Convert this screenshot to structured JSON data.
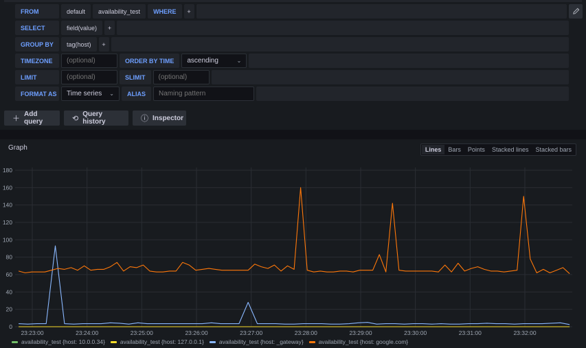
{
  "query_editor": {
    "from": {
      "label": "FROM",
      "policy": "default",
      "measurement": "availability_test",
      "where_label": "WHERE",
      "add": "+"
    },
    "select": {
      "label": "SELECT",
      "field": "field(value)",
      "add": "+"
    },
    "group_by": {
      "label": "GROUP BY",
      "tag": "tag(host)",
      "add": "+"
    },
    "timezone": {
      "label": "TIMEZONE",
      "placeholder": "(optional)",
      "order_label": "ORDER BY TIME",
      "order_value": "ascending"
    },
    "limit": {
      "label": "LIMIT",
      "placeholder": "(optional)",
      "slimit_label": "SLIMIT",
      "slimit_placeholder": "(optional)"
    },
    "format": {
      "label": "FORMAT AS",
      "value": "Time series",
      "alias_label": "ALIAS",
      "alias_placeholder": "Naming pattern"
    },
    "edit_icon": "pencil-icon"
  },
  "actions": {
    "add_query": {
      "label": "Add query",
      "icon": "plus-icon"
    },
    "query_history": {
      "label": "Query history",
      "icon": "history-icon"
    },
    "inspector": {
      "label": "Inspector",
      "icon": "info-icon"
    }
  },
  "panel": {
    "title": "Graph",
    "viz_tabs": [
      "Lines",
      "Bars",
      "Points",
      "Stacked lines",
      "Stacked bars"
    ],
    "active_tab": "Lines"
  },
  "chart_data": {
    "type": "line",
    "title": "Graph",
    "xlabel": "",
    "ylabel": "",
    "ylim": [
      0,
      180
    ],
    "yticks": [
      0,
      20,
      40,
      60,
      80,
      100,
      120,
      140,
      160,
      180
    ],
    "xticks": [
      "23:23:00",
      "23:24:00",
      "23:25:00",
      "23:26:00",
      "23:27:00",
      "23:28:00",
      "23:29:00",
      "23:30:00",
      "23:31:00",
      "23:32:00"
    ],
    "x_start": "23:22:45",
    "x_step_seconds": 10,
    "grid": true,
    "legend_position": "bottom-left",
    "series": [
      {
        "name": "availability_test {host: 10.0.0.34}",
        "color": "#73bf69",
        "values": [
          0,
          0,
          0,
          0,
          0,
          0,
          0,
          0,
          0,
          0,
          0,
          0,
          0,
          0,
          0,
          0,
          0,
          0,
          0,
          0,
          0,
          0,
          0,
          0,
          0,
          0,
          0,
          0,
          0,
          0,
          0,
          0,
          0,
          0,
          0,
          0,
          0,
          0,
          0,
          0,
          0,
          0,
          0,
          0,
          0,
          0,
          0,
          0,
          0,
          0,
          0,
          0,
          0,
          0,
          0,
          0,
          0,
          0,
          0,
          0,
          0
        ]
      },
      {
        "name": "availability_test {host: 127.0.0.1}",
        "color": "#fade2a",
        "values": [
          0,
          0,
          0,
          0,
          0,
          0,
          0,
          0,
          0,
          0,
          0,
          0,
          0,
          0,
          0,
          0,
          0,
          0,
          0,
          0,
          0,
          0,
          0,
          0,
          0,
          0,
          0,
          0,
          0,
          0,
          0,
          0,
          0,
          0,
          0,
          0,
          0,
          0,
          0,
          0,
          0,
          0,
          0,
          0,
          0,
          0,
          0,
          0,
          0,
          0,
          0,
          0,
          0,
          0,
          0,
          0,
          0,
          0,
          0,
          0,
          0
        ]
      },
      {
        "name": "availability_test {host: _gateway}",
        "color": "#8ab8ff",
        "values": [
          3.5,
          3,
          3.5,
          3.5,
          93,
          3.5,
          3,
          3.5,
          3.5,
          3.5,
          4.5,
          4,
          3,
          4.5,
          3.5,
          3.5,
          3.5,
          3.5,
          3.5,
          3.5,
          3.5,
          4.5,
          3.5,
          3.5,
          3.5,
          28,
          3.5,
          3.5,
          3.5,
          3,
          3,
          3.5,
          3.5,
          3.5,
          3,
          3,
          3.5,
          4.5,
          5,
          3,
          3.5,
          3.5,
          3,
          3.5,
          3.5,
          3,
          3.5,
          3,
          3,
          3.5,
          3.5,
          4,
          3.5,
          3.5,
          3,
          3.5,
          3.5,
          3.5,
          4,
          4.5,
          2.5
        ]
      },
      {
        "name": "availability_test {host: google.com}",
        "color": "#ff780a",
        "values": [
          64,
          62,
          63,
          63,
          63,
          65,
          67,
          66,
          68,
          65,
          70,
          65,
          66,
          66,
          69,
          74,
          64,
          69,
          68,
          71,
          64,
          63,
          63,
          64,
          64,
          74,
          71,
          65,
          66,
          67,
          66,
          65,
          65,
          65,
          65,
          65,
          72,
          69,
          67,
          71,
          64,
          70,
          66,
          160,
          65,
          63,
          64,
          63,
          63,
          64,
          64,
          63,
          65,
          65,
          65,
          83,
          63,
          142,
          65,
          64,
          64,
          64,
          64,
          64,
          63,
          71,
          63,
          73,
          64,
          67,
          69,
          66,
          64,
          64,
          63,
          64,
          65,
          150,
          78,
          62,
          66,
          62,
          65,
          68,
          61
        ]
      }
    ]
  }
}
